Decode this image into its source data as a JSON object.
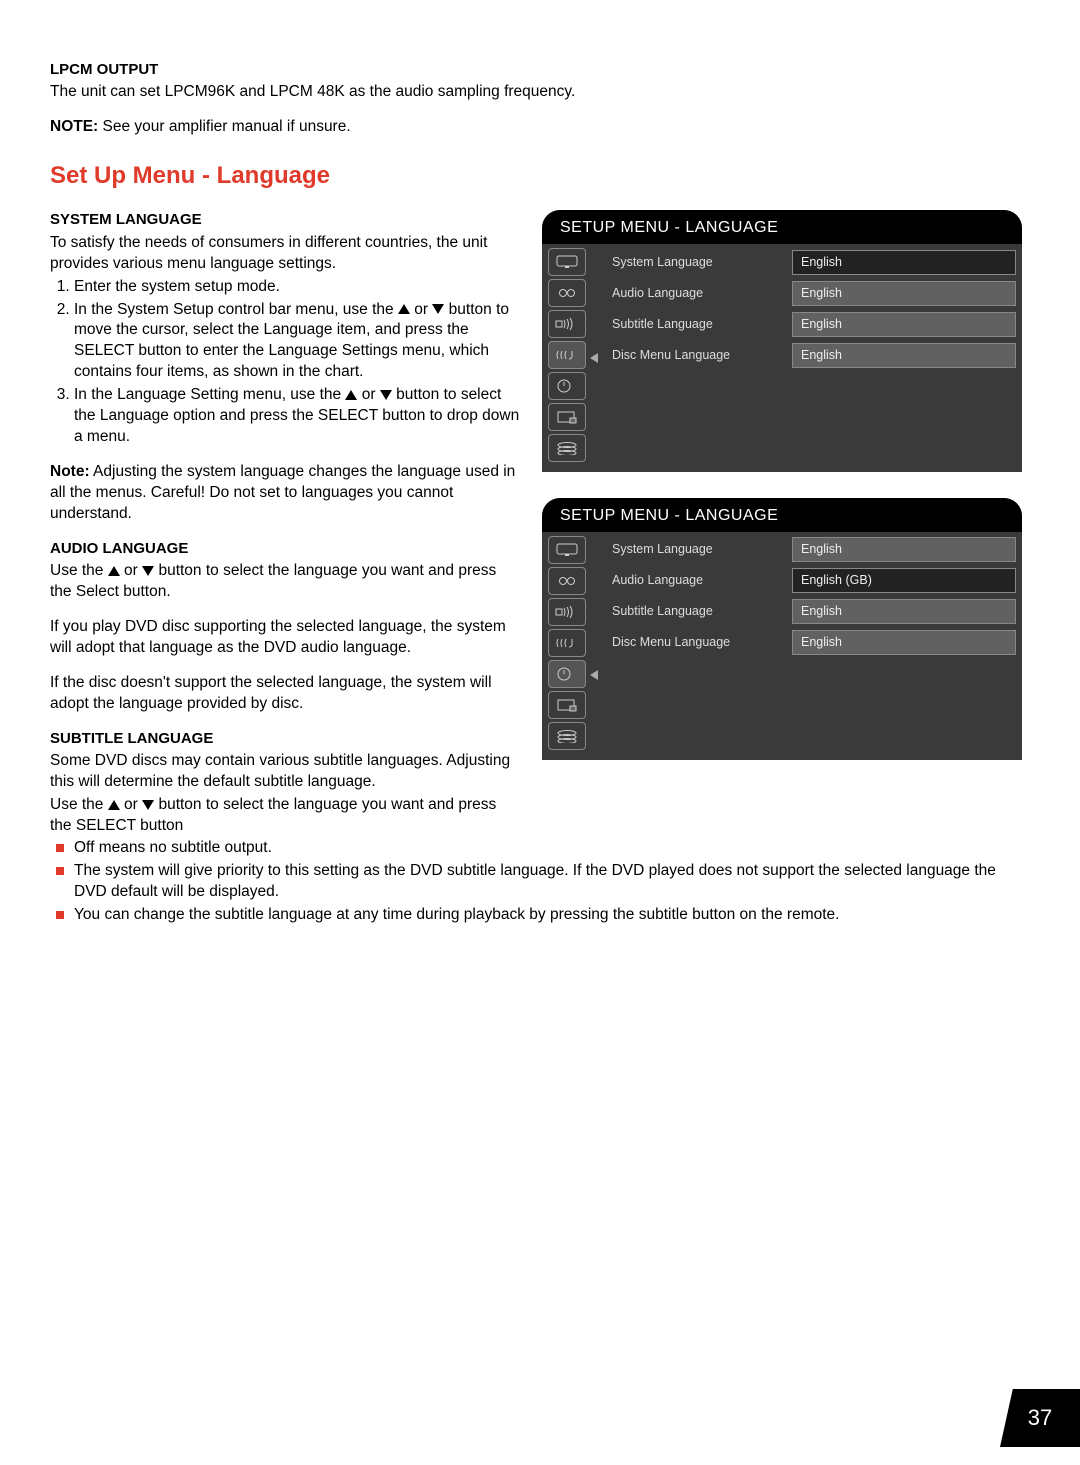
{
  "lpcm": {
    "heading": "Lpcm Output",
    "text": "The unit can set LPCM96K and LPCM 48K as the audio sampling frequency.",
    "note_label": "NOTE:",
    "note_text": " See your amplifier manual if unsure."
  },
  "section_title": "Set Up Menu - Language",
  "syslang": {
    "heading": "System Language",
    "intro": "To satisfy the needs of consumers in different countries, the unit provides various menu language settings.",
    "li1": "Enter the system setup mode.",
    "li2a": "In the System Setup control bar menu, use the ",
    "li2b": " or ",
    "li2c": " button to move the cursor, select the Language item, and press the SELECT button to enter the Language Settings menu, which contains four items, as shown in the chart.",
    "li3a": "In the Language Setting menu, use the ",
    "li3b": " or ",
    "li3c": " button to select the Language option and press the SELECT button to drop down a menu.",
    "note_label": "Note:",
    "note_text": " Adjusting the system language changes the language used in all the menus. Careful! Do not set to languages you cannot understand."
  },
  "audiolang": {
    "heading": "Audio Language",
    "p1a": "Use the ",
    "p1b": " or ",
    "p1c": " button to select the language you want and press the Select button.",
    "p2": "If you play DVD disc supporting the selected language, the system will adopt that language as the DVD audio language.",
    "p3": "If the disc doesn't support the selected language, the system will adopt the language provided by disc."
  },
  "sublang": {
    "heading": "Subtitle Language",
    "p1": "Some DVD discs may contain various subtitle languages. Adjusting this will determine the default subtitle language.",
    "p2a": "Use the ",
    "p2b": " or ",
    "p2c": " button to select the language you want and press the SELECT button",
    "b1": "Off means no subtitle output.",
    "b2": "The system will give priority to this setting as the DVD subtitle language. If the DVD played does not support the selected language the DVD default will be displayed.",
    "b3": "You can change the subtitle language at any time during playback by pressing the subtitle button on the remote."
  },
  "osd1": {
    "title": "SETUP MENU - LANGUAGE",
    "rows": [
      {
        "label": "System Language",
        "value": "English",
        "hl": true
      },
      {
        "label": "Audio Language",
        "value": "English"
      },
      {
        "label": "Subtitle Language",
        "value": "English"
      },
      {
        "label": "Disc Menu Language",
        "value": "English"
      }
    ],
    "selected_icon": 3
  },
  "osd2": {
    "title": "SETUP MENU - LANGUAGE",
    "rows": [
      {
        "label": "System Language",
        "value": "English"
      },
      {
        "label": "Audio Language",
        "value": "English (GB)",
        "hl": true
      },
      {
        "label": "Subtitle Language",
        "value": "English"
      },
      {
        "label": "Disc Menu Language",
        "value": "English"
      }
    ],
    "selected_icon": 4
  },
  "page_number": "37"
}
